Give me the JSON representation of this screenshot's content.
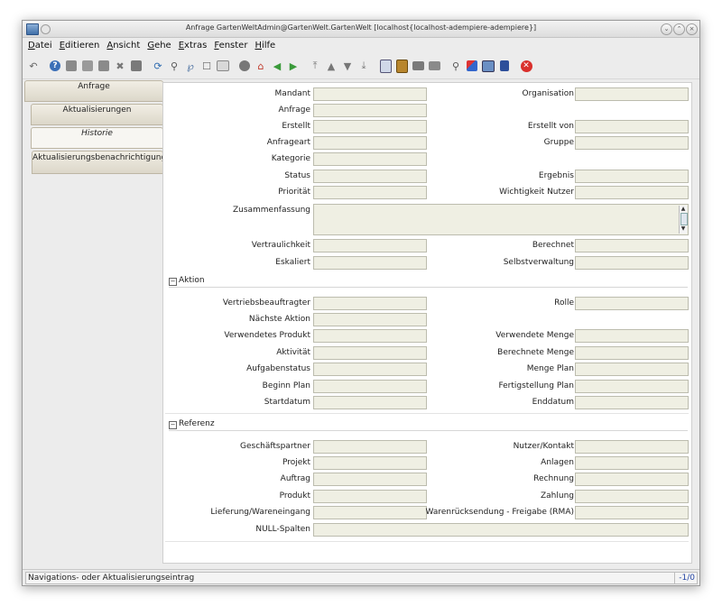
{
  "window": {
    "title": "Anfrage  GartenWeltAdmin@GartenWelt.GartenWelt [localhost{localhost-adempiere-adempiere}]"
  },
  "menu": [
    {
      "key": "D",
      "rest": "atei"
    },
    {
      "key": "E",
      "rest": "ditieren"
    },
    {
      "key": "A",
      "rest": "nsicht"
    },
    {
      "key": "G",
      "rest": "ehe"
    },
    {
      "key": "E",
      "rest": "xtras"
    },
    {
      "key": "F",
      "rest": "enster"
    },
    {
      "key": "H",
      "rest": "ilfe"
    }
  ],
  "tabs": [
    "Anfrage",
    "Aktualisierungen",
    "Historie",
    "Aktualisierungsbenachrichtigung"
  ],
  "fields": {
    "mandant": "Mandant",
    "organisation": "Organisation",
    "anfrage": "Anfrage",
    "erstellt": "Erstellt",
    "erstellt_von": "Erstellt von",
    "anfrageart": "Anfrageart",
    "gruppe": "Gruppe",
    "kategorie": "Kategorie",
    "status": "Status",
    "ergebnis": "Ergebnis",
    "prioritaet": "Priorität",
    "wichtigkeit": "Wichtigkeit Nutzer",
    "zusammenfassung": "Zusammenfassung",
    "vertraulichkeit": "Vertraulichkeit",
    "berechnet": "Berechnet",
    "eskaliert": "Eskaliert",
    "selbstverwaltung": "Selbstverwaltung"
  },
  "aktion": {
    "caption": "Aktion",
    "vertriebsbeauftragter": "Vertriebsbeauftragter",
    "rolle": "Rolle",
    "naechste_aktion": "Nächste Aktion",
    "verwendetes_produkt": "Verwendetes Produkt",
    "verwendete_menge": "Verwendete Menge",
    "aktivitaet": "Aktivität",
    "berechnete_menge": "Berechnete Menge",
    "aufgabenstatus": "Aufgabenstatus",
    "menge_plan": "Menge Plan",
    "beginn_plan": "Beginn Plan",
    "fertigstellung_plan": "Fertigstellung Plan",
    "startdatum": "Startdatum",
    "enddatum": "Enddatum"
  },
  "referenz": {
    "caption": "Referenz",
    "geschaeftspartner": "Geschäftspartner",
    "nutzer_kontakt": "Nutzer/Kontakt",
    "projekt": "Projekt",
    "anlagen": "Anlagen",
    "auftrag": "Auftrag",
    "rechnung": "Rechnung",
    "produkt": "Produkt",
    "zahlung": "Zahlung",
    "lieferung": "Lieferung/Wareneingang",
    "rma": "Warenrücksendung - Freigabe (RMA)",
    "null_spalten": "NULL-Spalten"
  },
  "status": {
    "text": "Navigations- oder Aktualisierungseintrag",
    "count": "-1/0"
  },
  "colors": {
    "field_bg": "#efefe3",
    "tab_bg": "#dcd7c9",
    "accent": "#2546a5"
  }
}
